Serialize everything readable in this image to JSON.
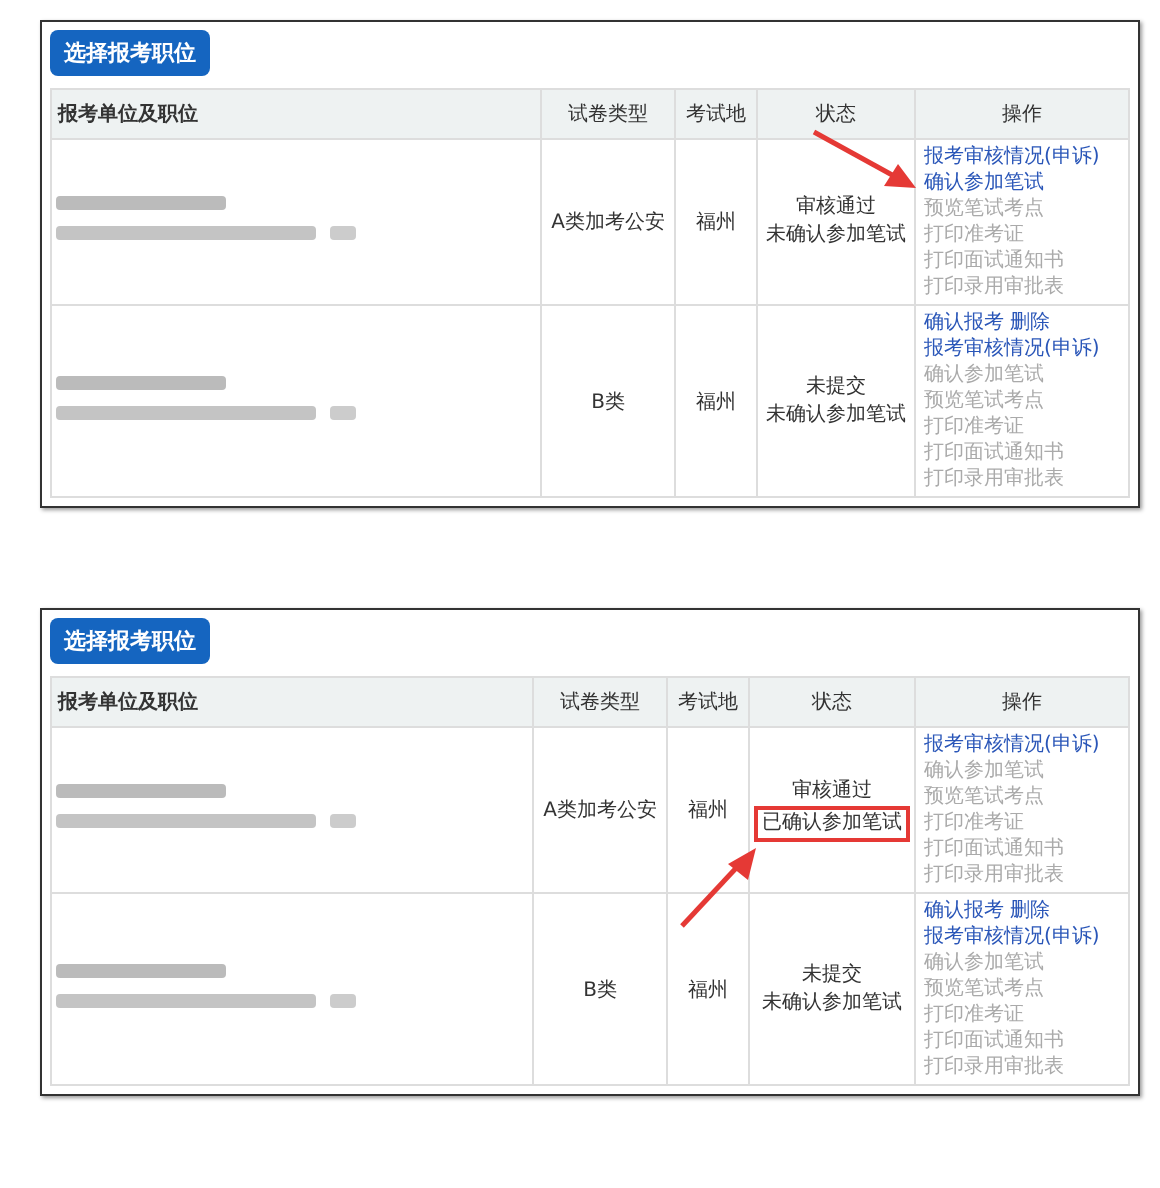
{
  "panels": [
    {
      "button": "选择报考职位",
      "columns": [
        "报考单位及职位",
        "试卷类型",
        "考试地",
        "状态",
        "操作"
      ],
      "rows": [
        {
          "type": "A类加考公安",
          "place": "福州",
          "status": [
            {
              "text": "审核通过",
              "highlighted": false
            },
            {
              "text": "未确认参加笔试",
              "highlighted": false
            }
          ],
          "operations": [
            {
              "links": [
                {
                  "label": "报考审核情况(申诉)",
                  "enabled": true
                }
              ]
            },
            {
              "links": [
                {
                  "label": "确认参加笔试",
                  "enabled": true,
                  "pointed_at": true
                }
              ]
            },
            {
              "links": [
                {
                  "label": "预览笔试考点",
                  "enabled": false
                }
              ]
            },
            {
              "links": [
                {
                  "label": "打印准考证",
                  "enabled": false
                }
              ]
            },
            {
              "links": [
                {
                  "label": "打印面试通知书",
                  "enabled": false
                }
              ]
            },
            {
              "links": [
                {
                  "label": "打印录用审批表",
                  "enabled": false
                }
              ]
            }
          ]
        },
        {
          "type": "B类",
          "place": "福州",
          "status": [
            {
              "text": "未提交",
              "highlighted": false
            },
            {
              "text": "未确认参加笔试",
              "highlighted": false
            }
          ],
          "operations": [
            {
              "links": [
                {
                  "label": "确认报考",
                  "enabled": true
                },
                {
                  "label": "删除",
                  "enabled": true
                }
              ]
            },
            {
              "links": [
                {
                  "label": "报考审核情况(申诉)",
                  "enabled": true
                }
              ]
            },
            {
              "links": [
                {
                  "label": "确认参加笔试",
                  "enabled": false
                }
              ]
            },
            {
              "links": [
                {
                  "label": "预览笔试考点",
                  "enabled": false
                }
              ]
            },
            {
              "links": [
                {
                  "label": "打印准考证",
                  "enabled": false
                }
              ]
            },
            {
              "links": [
                {
                  "label": "打印面试通知书",
                  "enabled": false
                }
              ]
            },
            {
              "links": [
                {
                  "label": "打印录用审批表",
                  "enabled": false
                }
              ]
            }
          ]
        }
      ]
    },
    {
      "button": "选择报考职位",
      "columns": [
        "报考单位及职位",
        "试卷类型",
        "考试地",
        "状态",
        "操作"
      ],
      "rows": [
        {
          "type": "A类加考公安",
          "place": "福州",
          "status": [
            {
              "text": "审核通过",
              "highlighted": false
            },
            {
              "text": "已确认参加笔试",
              "highlighted": true,
              "pointed_at": true
            }
          ],
          "operations": [
            {
              "links": [
                {
                  "label": "报考审核情况(申诉)",
                  "enabled": true
                }
              ]
            },
            {
              "links": [
                {
                  "label": "确认参加笔试",
                  "enabled": false
                }
              ]
            },
            {
              "links": [
                {
                  "label": "预览笔试考点",
                  "enabled": false
                }
              ]
            },
            {
              "links": [
                {
                  "label": "打印准考证",
                  "enabled": false
                }
              ]
            },
            {
              "links": [
                {
                  "label": "打印面试通知书",
                  "enabled": false
                }
              ]
            },
            {
              "links": [
                {
                  "label": "打印录用审批表",
                  "enabled": false
                }
              ]
            }
          ]
        },
        {
          "type": "B类",
          "place": "福州",
          "status": [
            {
              "text": "未提交",
              "highlighted": false
            },
            {
              "text": "未确认参加笔试",
              "highlighted": false
            }
          ],
          "operations": [
            {
              "links": [
                {
                  "label": "确认报考",
                  "enabled": true
                },
                {
                  "label": "删除",
                  "enabled": true
                }
              ]
            },
            {
              "links": [
                {
                  "label": "报考审核情况(申诉)",
                  "enabled": true
                }
              ]
            },
            {
              "links": [
                {
                  "label": "确认参加笔试",
                  "enabled": false
                }
              ]
            },
            {
              "links": [
                {
                  "label": "预览笔试考点",
                  "enabled": false
                }
              ]
            },
            {
              "links": [
                {
                  "label": "打印准考证",
                  "enabled": false
                }
              ]
            },
            {
              "links": [
                {
                  "label": "打印面试通知书",
                  "enabled": false
                }
              ]
            },
            {
              "links": [
                {
                  "label": "打印录用审批表",
                  "enabled": false
                }
              ]
            }
          ]
        }
      ]
    }
  ]
}
